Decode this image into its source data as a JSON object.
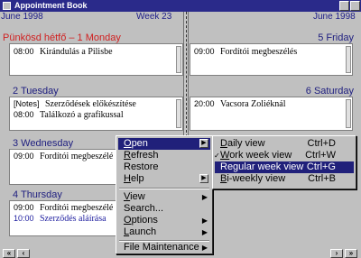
{
  "window": {
    "title": "Appointment Book"
  },
  "header": {
    "left_month": "June 1998",
    "week": "Week 23",
    "right_month": "June 1998"
  },
  "days": {
    "monday": {
      "label": "Pünkösd hétfő –  1 Monday",
      "entries": [
        {
          "time": "08:00",
          "text": "Kirándulás a Pilisbe"
        }
      ]
    },
    "friday": {
      "label": "5 Friday",
      "entries": [
        {
          "time": "09:00",
          "text": "Fordítói megbeszélés"
        }
      ]
    },
    "tuesday": {
      "label": "2 Tuesday",
      "entries": [
        {
          "time": "[Notes]",
          "text": "Szerződések előkészítése"
        },
        {
          "time": "08:00",
          "text": "Találkozó a grafikussal"
        }
      ]
    },
    "saturday": {
      "label": "6 Saturday",
      "entries": [
        {
          "time": "20:00",
          "text": "Vacsora Zoliéknál"
        }
      ]
    },
    "wednesday": {
      "label": "3 Wednesday",
      "entries": [
        {
          "time": "09:00",
          "text": "Fordítói megbeszélé"
        }
      ]
    },
    "thursday": {
      "label": "4 Thursday",
      "entries": [
        {
          "time": "09:00",
          "text": "Fordítói megbeszélé"
        },
        {
          "time": "10:00",
          "text": "Szerződés aláírása"
        }
      ]
    }
  },
  "context_menu": {
    "items": [
      {
        "label": "Open",
        "hotkey": "O",
        "rest": "pen",
        "submenu": true,
        "selected": true
      },
      {
        "label": "Refresh",
        "hotkey": "R",
        "rest": "efresh"
      },
      {
        "label": "Restore",
        "hotkey": "",
        "rest": "Restore"
      },
      {
        "label": "Help",
        "hotkey": "H",
        "rest": "elp",
        "submenu": true
      },
      {
        "label": "View",
        "hotkey": "V",
        "rest": "iew",
        "submenu": true
      },
      {
        "label": "Search...",
        "hotkey": "",
        "rest": "Search..."
      },
      {
        "label": "Options",
        "hotkey": "O",
        "rest": "ptions",
        "submenu": true
      },
      {
        "label": "Launch",
        "hotkey": "L",
        "rest": "aunch",
        "submenu": true
      },
      {
        "label": "File Maintenance",
        "hotkey": "",
        "rest": "File Maintenance",
        "submenu": true
      }
    ]
  },
  "submenu": {
    "items": [
      {
        "hotkey": "D",
        "rest": "aily view",
        "shortcut": "Ctrl+D",
        "checked": false
      },
      {
        "hotkey": "W",
        "rest": "ork week view",
        "shortcut": "Ctrl+W",
        "checked": true
      },
      {
        "hotkey": "",
        "rest": "Regular week view",
        "shortcut": "Ctrl+G",
        "selected": true
      },
      {
        "hotkey": "B",
        "rest": "i-weekly view",
        "shortcut": "Ctrl+B"
      }
    ]
  },
  "nav": {
    "first": "«",
    "prev": "‹",
    "next": "›",
    "last": "»"
  },
  "colors": {
    "title_bar": "#2a2a8a",
    "holiday_red": "#d02020",
    "day_label_blue": "#202080",
    "menu_highlight": "#20207a"
  }
}
